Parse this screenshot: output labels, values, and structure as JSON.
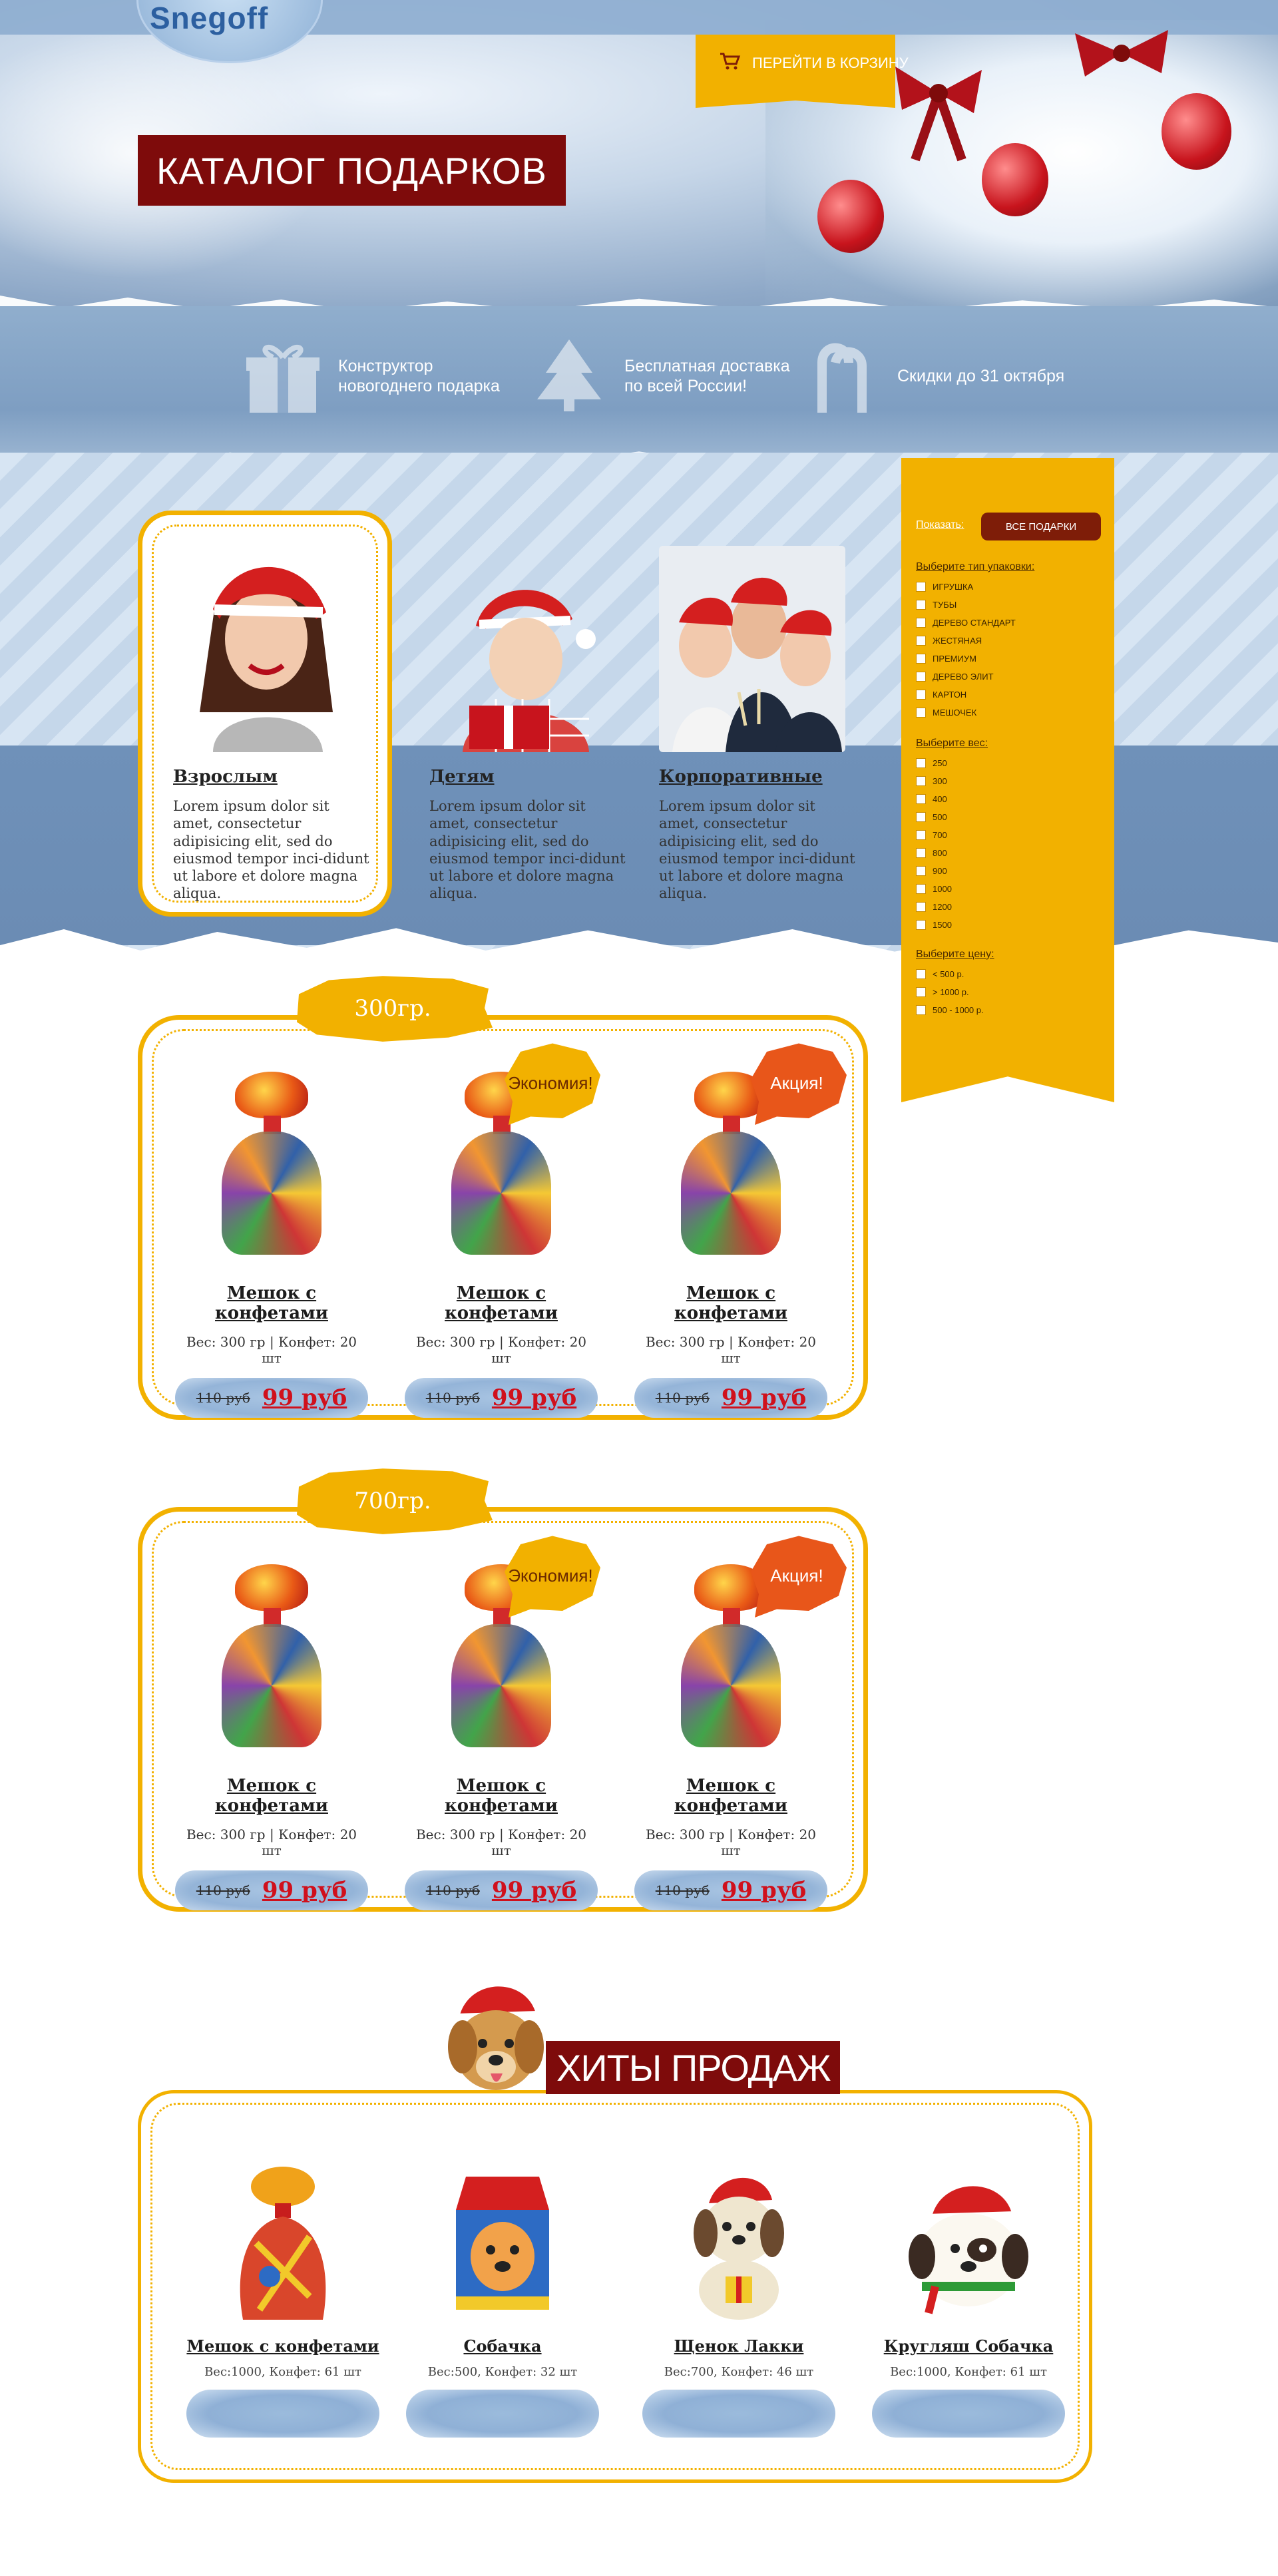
{
  "header": {
    "logo_text": "Snegoff",
    "cart_label": "ПЕРЕЙТИ В КОРЗИНУ",
    "page_title": "КАТАЛОГ ПОДАРКОВ"
  },
  "features": [
    {
      "icon": "gift-icon",
      "line1": "Конструктор",
      "line2": "новогоднего подарка"
    },
    {
      "icon": "christmas-tree-icon",
      "line1": "Бесплатная доставка",
      "line2": "по всей России!"
    },
    {
      "icon": "candy-cane-icon",
      "line1": "Скидки до 31 октября",
      "line2": ""
    }
  ],
  "categories": [
    {
      "title": "Взрослым",
      "text": "Lorem ipsum dolor sit amet, consectetur adipisicing elit, sed do eiusmod tempor inci-didunt ut labore et dolore magna aliqua."
    },
    {
      "title": "Детям",
      "text": "Lorem ipsum dolor sit amet, consectetur adipisicing elit, sed do eiusmod tempor inci-didunt ut labore et dolore magna aliqua."
    },
    {
      "title": "Корпоративные",
      "text": "Lorem ipsum dolor sit amet, consectetur adipisicing elit, sed do eiusmod tempor inci-didunt ut labore et dolore magna aliqua."
    }
  ],
  "filters": {
    "show_label": "Показать:",
    "all_button": "ВСЕ ПОДАРКИ",
    "packaging_title": "Выберите тип упаковки:",
    "packaging": [
      "ИГРУШКА",
      "ТУБЫ",
      "ДЕРЕВО СТАНДАРТ",
      "ЖЕСТЯНАЯ",
      "ПРЕМИУМ",
      "ДЕРЕВО ЭЛИТ",
      "КАРТОН",
      "МЕШОЧЕК"
    ],
    "weight_title": "Выберите вес:",
    "weights": [
      "250",
      "300",
      "400",
      "500",
      "700",
      "800",
      "900",
      "1000",
      "1200",
      "1500"
    ],
    "price_title": "Выберите цену:",
    "prices": [
      "< 500 р.",
      "> 1000 р.",
      "500 - 1000 р."
    ]
  },
  "groups": [
    {
      "label": "300гр.",
      "products": [
        {
          "badge": "",
          "title": "Мешок с конфетами",
          "info": "Вес: 300 гр | Конфет: 20 шт",
          "old_price": "110 руб",
          "new_price": "99 руб"
        },
        {
          "badge": "Экономия!",
          "title": "Мешок с конфетами",
          "info": "Вес: 300 гр | Конфет: 20 шт",
          "old_price": "110 руб",
          "new_price": "99 руб"
        },
        {
          "badge": "Акция!",
          "title": "Мешок с конфетами",
          "info": "Вес: 300 гр | Конфет: 20 шт",
          "old_price": "110 руб",
          "new_price": "99 руб"
        }
      ]
    },
    {
      "label": "700гр.",
      "products": [
        {
          "badge": "",
          "title": "Мешок с конфетами",
          "info": "Вес: 300 гр | Конфет: 20 шт",
          "old_price": "110 руб",
          "new_price": "99 руб"
        },
        {
          "badge": "Экономия!",
          "title": "Мешок с конфетами",
          "info": "Вес: 300 гр | Конфет: 20 шт",
          "old_price": "110 руб",
          "new_price": "99 руб"
        },
        {
          "badge": "Акция!",
          "title": "Мешок с конфетами",
          "info": "Вес: 300 гр | Конфет: 20 шт",
          "old_price": "110 руб",
          "new_price": "99 руб"
        }
      ]
    }
  ],
  "hits": {
    "title": "ХИТЫ ПРОДАЖ",
    "items": [
      {
        "title": "Мешок с конфетами",
        "info": "Вес:1000, Конфет: 61 шт"
      },
      {
        "title": "Собачка",
        "info": "Вес:500, Конфет: 32 шт"
      },
      {
        "title": "Щенок Лакки",
        "info": "Вес:700, Конфет: 46 шт"
      },
      {
        "title": "Кругляш Собачка",
        "info": "Вес:1000, Конфет: 61 шт"
      }
    ]
  },
  "colors": {
    "accent": "#f2b100",
    "brand_dark": "#7e0b0b",
    "price": "#d0101c",
    "sky": "#7e9ec2"
  }
}
